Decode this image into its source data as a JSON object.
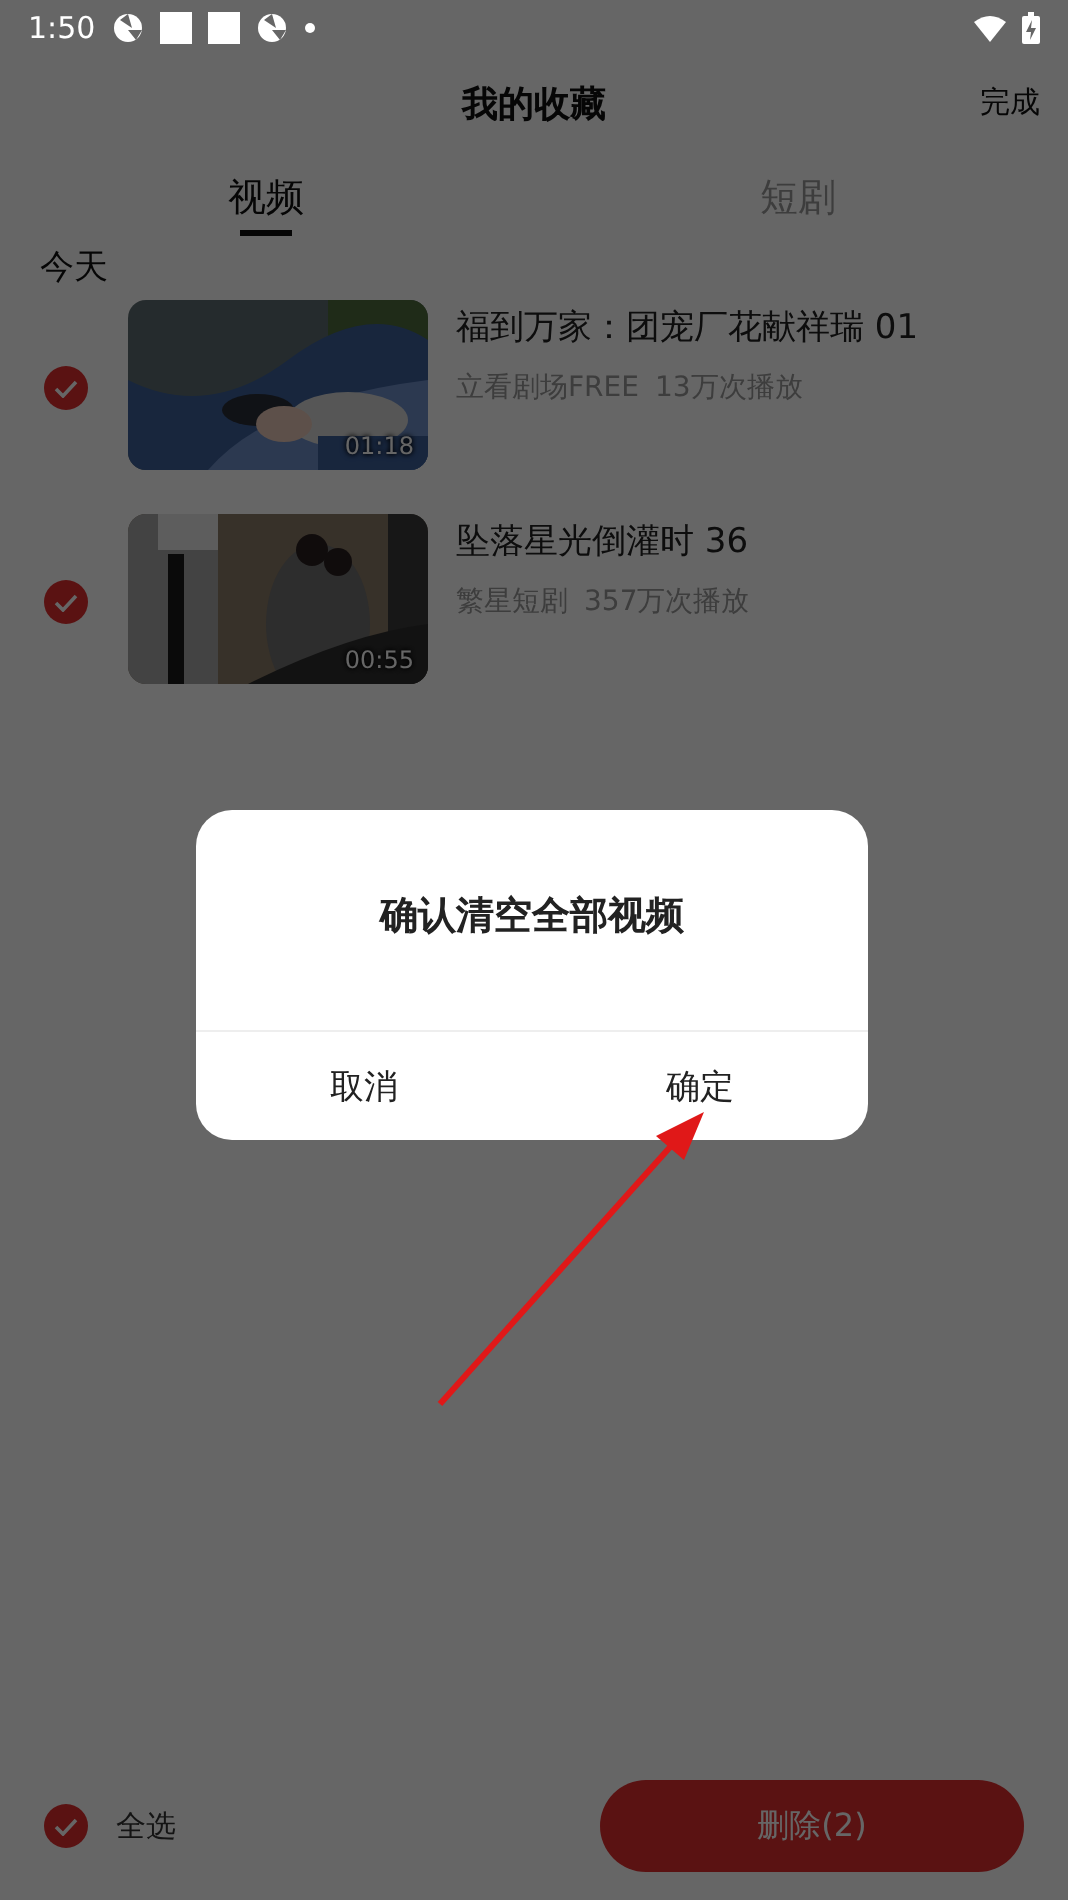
{
  "status_bar": {
    "time": "1:50"
  },
  "header": {
    "title": "我的收藏",
    "action": "完成"
  },
  "tabs": [
    {
      "label": "视频",
      "selected": true
    },
    {
      "label": "短剧",
      "selected": false
    }
  ],
  "section": "今天",
  "videos": [
    {
      "title": "福到万家：团宠厂花献祥瑞 01",
      "source": "立看剧场FREE",
      "plays": "13万次播放",
      "duration": "01:18",
      "checked": true,
      "kind": "picture"
    },
    {
      "title": "坠落星光倒灌时 36",
      "source": "繁星短剧",
      "plays": "357万次播放",
      "duration": "00:55",
      "checked": true,
      "kind": "picture"
    }
  ],
  "bottom_bar": {
    "select_all": {
      "label": "全选",
      "checked": true
    },
    "delete_button": "删除(2)"
  },
  "dialog": {
    "message": "确认清空全部视频",
    "buttons": [
      "取消",
      "确定"
    ]
  }
}
